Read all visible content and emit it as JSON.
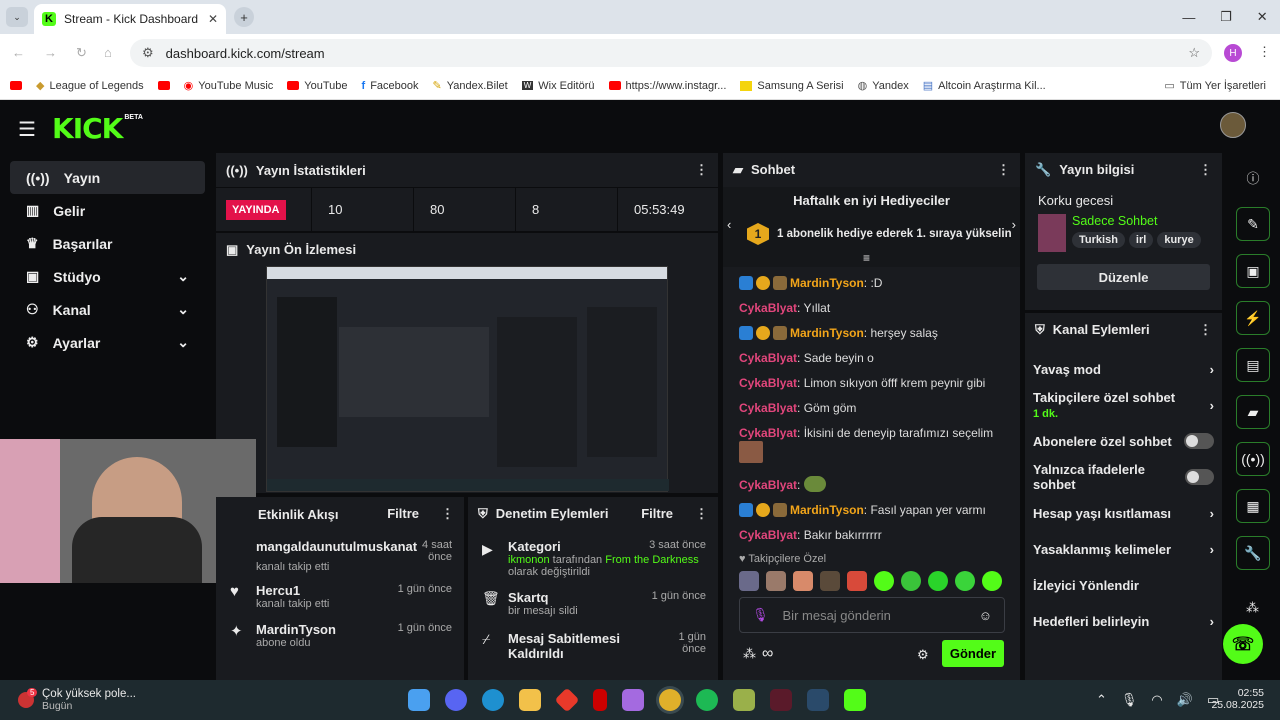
{
  "browser": {
    "tab_title": "Stream - Kick Dashboard",
    "url": "dashboard.kick.com/stream",
    "profile_initial": "H",
    "bookmarks": [
      "League of Legends",
      "YouTube Music",
      "YouTube",
      "Facebook",
      "Yandex.Bilet",
      "Wix Editörü",
      "https://www.instagr...",
      "Samsung A Serisi",
      "Yandex",
      "Altcoin Araştırma Kil..."
    ],
    "all_bookmarks": "Tüm Yer İşaretleri"
  },
  "app": {
    "logo": "KICK",
    "beta": "BETA",
    "sidebar": [
      {
        "label": "Yayın",
        "icon": "broadcast-icon"
      },
      {
        "label": "Gelir",
        "icon": "revenue-icon"
      },
      {
        "label": "Başarılar",
        "icon": "trophy-icon"
      },
      {
        "label": "Stüdyo",
        "icon": "studio-icon"
      },
      {
        "label": "Kanal",
        "icon": "channel-icon"
      },
      {
        "label": "Ayarlar",
        "icon": "gear-icon"
      }
    ]
  },
  "stats": {
    "title": "Yayın İstatistikleri",
    "live": "YAYINDA",
    "values": [
      "10",
      "80",
      "8",
      "05:53:49"
    ]
  },
  "preview": {
    "title": "Yayın Ön İzlemesi"
  },
  "activity": {
    "title": "Etkinlik Akışı",
    "filter": "Filtre",
    "items": [
      {
        "name": "mangaldaunutulmuskanat",
        "sub": "kanalı takip etti",
        "time": "4 saat önce"
      },
      {
        "name": "Hercu1",
        "sub": "kanalı takip etti",
        "time": "1 gün önce"
      },
      {
        "name": "MardinTyson",
        "sub": "abone oldu",
        "time": "1 gün önce"
      }
    ]
  },
  "moderation": {
    "title": "Denetim Eylemleri",
    "filter": "Filtre",
    "items": [
      {
        "name": "Kategori",
        "sub_user": "ikmonon",
        "sub_mid": "tarafından",
        "sub_target": "From the Darkness",
        "sub_end": "olarak değiştirildi",
        "time": "3 saat önce"
      },
      {
        "name": "Skartq",
        "sub": "bir mesajı sildi",
        "time": "1 gün önce"
      },
      {
        "name": "Mesaj Sabitlemesi Kaldırıldı",
        "time": "1 gün önce"
      }
    ]
  },
  "chat": {
    "title": "Sohbet",
    "top_gifters": "Haftalık en iyi Hediyeciler",
    "gift_rank": "1",
    "gift_text": "1 abonelik hediye ederek 1. sıraya yükselin",
    "messages": [
      {
        "user": "MardinTyson",
        "text": ": :D",
        "type": "sub"
      },
      {
        "user": "CykaBlyat",
        "text": ": Yıllat",
        "type": "plain"
      },
      {
        "user": "MardinTyson",
        "text": ": herşey salaş",
        "type": "sub"
      },
      {
        "user": "CykaBlyat",
        "text": ": Sade beyin o",
        "type": "plain"
      },
      {
        "user": "CykaBlyat",
        "text": ": Limon sıkıyon öfff krem peynir gibi",
        "type": "plain"
      },
      {
        "user": "CykaBlyat",
        "text": ": Göm göm",
        "type": "plain"
      },
      {
        "user": "CykaBlyat",
        "text": ": İkisini de deneyip tarafımızı seçelim",
        "type": "plain"
      },
      {
        "user": "CykaBlyat",
        "text": ":",
        "type": "plain"
      },
      {
        "user": "MardinTyson",
        "text": ": Fasıl yapan yer varmı",
        "type": "sub"
      },
      {
        "user": "CykaBlyat",
        "text": ": Bakır bakırrrrrr",
        "type": "plain"
      }
    ],
    "followers_only": "Takipçilere Özel",
    "placeholder": "Bir mesaj gönderin",
    "send": "Gönder",
    "infinity": "∞"
  },
  "stream_info": {
    "title": "Yayın bilgisi",
    "stream_title": "Korku gecesi",
    "category": "Sadece Sohbet",
    "tags": [
      "Turkish",
      "irl",
      "kurye"
    ],
    "edit": "Düzenle"
  },
  "channel_actions": {
    "title": "Kanal Eylemleri",
    "items": [
      {
        "label": "Yavaş mod",
        "control": "arrow"
      },
      {
        "label": "Takipçilere özel sohbet",
        "sub": "1 dk.",
        "control": "arrow"
      },
      {
        "label": "Abonelere özel sohbet",
        "control": "toggle"
      },
      {
        "label": "Yalnızca ifadelerle sohbet",
        "control": "toggle"
      },
      {
        "label": "Hesap yaşı kısıtlaması",
        "control": "arrow"
      },
      {
        "label": "Yasaklanmış kelimeler",
        "control": "arrow"
      },
      {
        "label": "İzleyici Yönlendir",
        "control": "none"
      },
      {
        "label": "Hedefleri belirleyin",
        "control": "arrow"
      }
    ]
  },
  "taskbar": {
    "weather": "Çok yüksek pole...",
    "weather_sub": "Bugün",
    "badge": "5",
    "time": "02:55",
    "date": "25.08.2025"
  },
  "colors": {
    "accent": "#53fc18",
    "live": "#e3124a",
    "panel": "#191b1f"
  }
}
